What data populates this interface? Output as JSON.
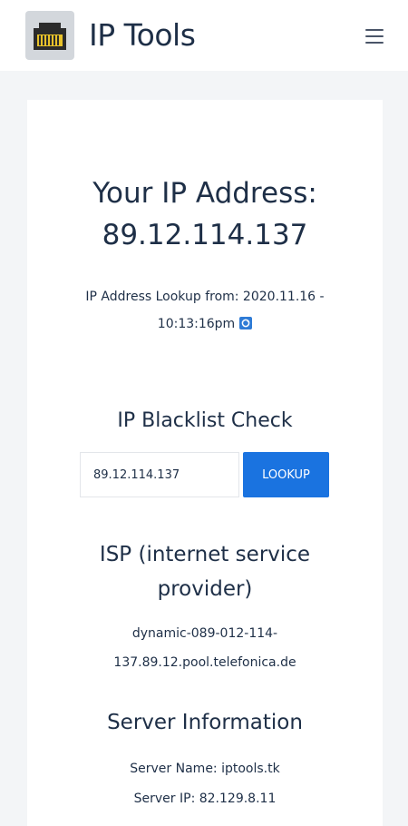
{
  "header": {
    "title": "IP Tools",
    "logo_icon": "ethernet-port-icon",
    "menu_icon": "hamburger-menu-icon"
  },
  "ip_section": {
    "heading": "Your IP Address:",
    "ip": "89.12.114.137",
    "lookup_from_line1": "IP Address Lookup from: 2020.11.16 -",
    "lookup_from_line2": "10:13:16pm",
    "refresh_icon": "refresh-icon"
  },
  "blacklist": {
    "title": "IP Blacklist Check",
    "input_value": "89.12.114.137",
    "button_label": "LOOKUP"
  },
  "isp": {
    "title_line1": "ISP (internet service",
    "title_line2": "provider)",
    "value_line1": "dynamic-089-012-114-",
    "value_line2": "137.89.12.pool.telefonica.de"
  },
  "server": {
    "title": "Server Information",
    "name_line": "Server Name: iptools.tk",
    "ip_line": "Server IP: 82.129.8.11"
  },
  "colors": {
    "accent": "#1a73e0",
    "text": "#1e2f47",
    "background": "#f3f5f7"
  }
}
